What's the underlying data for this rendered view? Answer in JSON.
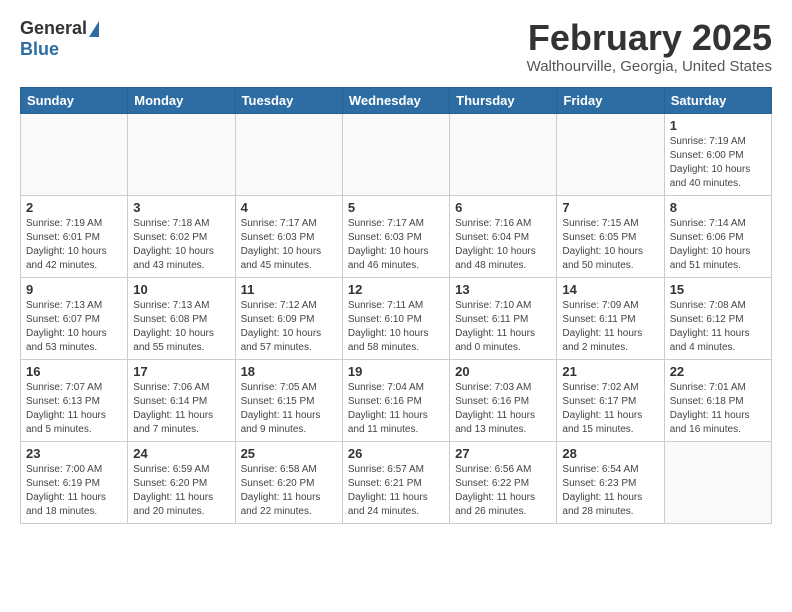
{
  "header": {
    "logo_general": "General",
    "logo_blue": "Blue",
    "month_title": "February 2025",
    "location": "Walthourville, Georgia, United States"
  },
  "weekdays": [
    "Sunday",
    "Monday",
    "Tuesday",
    "Wednesday",
    "Thursday",
    "Friday",
    "Saturday"
  ],
  "weeks": [
    [
      {
        "day": "",
        "info": ""
      },
      {
        "day": "",
        "info": ""
      },
      {
        "day": "",
        "info": ""
      },
      {
        "day": "",
        "info": ""
      },
      {
        "day": "",
        "info": ""
      },
      {
        "day": "",
        "info": ""
      },
      {
        "day": "1",
        "info": "Sunrise: 7:19 AM\nSunset: 6:00 PM\nDaylight: 10 hours\nand 40 minutes."
      }
    ],
    [
      {
        "day": "2",
        "info": "Sunrise: 7:19 AM\nSunset: 6:01 PM\nDaylight: 10 hours\nand 42 minutes."
      },
      {
        "day": "3",
        "info": "Sunrise: 7:18 AM\nSunset: 6:02 PM\nDaylight: 10 hours\nand 43 minutes."
      },
      {
        "day": "4",
        "info": "Sunrise: 7:17 AM\nSunset: 6:03 PM\nDaylight: 10 hours\nand 45 minutes."
      },
      {
        "day": "5",
        "info": "Sunrise: 7:17 AM\nSunset: 6:03 PM\nDaylight: 10 hours\nand 46 minutes."
      },
      {
        "day": "6",
        "info": "Sunrise: 7:16 AM\nSunset: 6:04 PM\nDaylight: 10 hours\nand 48 minutes."
      },
      {
        "day": "7",
        "info": "Sunrise: 7:15 AM\nSunset: 6:05 PM\nDaylight: 10 hours\nand 50 minutes."
      },
      {
        "day": "8",
        "info": "Sunrise: 7:14 AM\nSunset: 6:06 PM\nDaylight: 10 hours\nand 51 minutes."
      }
    ],
    [
      {
        "day": "9",
        "info": "Sunrise: 7:13 AM\nSunset: 6:07 PM\nDaylight: 10 hours\nand 53 minutes."
      },
      {
        "day": "10",
        "info": "Sunrise: 7:13 AM\nSunset: 6:08 PM\nDaylight: 10 hours\nand 55 minutes."
      },
      {
        "day": "11",
        "info": "Sunrise: 7:12 AM\nSunset: 6:09 PM\nDaylight: 10 hours\nand 57 minutes."
      },
      {
        "day": "12",
        "info": "Sunrise: 7:11 AM\nSunset: 6:10 PM\nDaylight: 10 hours\nand 58 minutes."
      },
      {
        "day": "13",
        "info": "Sunrise: 7:10 AM\nSunset: 6:11 PM\nDaylight: 11 hours\nand 0 minutes."
      },
      {
        "day": "14",
        "info": "Sunrise: 7:09 AM\nSunset: 6:11 PM\nDaylight: 11 hours\nand 2 minutes."
      },
      {
        "day": "15",
        "info": "Sunrise: 7:08 AM\nSunset: 6:12 PM\nDaylight: 11 hours\nand 4 minutes."
      }
    ],
    [
      {
        "day": "16",
        "info": "Sunrise: 7:07 AM\nSunset: 6:13 PM\nDaylight: 11 hours\nand 5 minutes."
      },
      {
        "day": "17",
        "info": "Sunrise: 7:06 AM\nSunset: 6:14 PM\nDaylight: 11 hours\nand 7 minutes."
      },
      {
        "day": "18",
        "info": "Sunrise: 7:05 AM\nSunset: 6:15 PM\nDaylight: 11 hours\nand 9 minutes."
      },
      {
        "day": "19",
        "info": "Sunrise: 7:04 AM\nSunset: 6:16 PM\nDaylight: 11 hours\nand 11 minutes."
      },
      {
        "day": "20",
        "info": "Sunrise: 7:03 AM\nSunset: 6:16 PM\nDaylight: 11 hours\nand 13 minutes."
      },
      {
        "day": "21",
        "info": "Sunrise: 7:02 AM\nSunset: 6:17 PM\nDaylight: 11 hours\nand 15 minutes."
      },
      {
        "day": "22",
        "info": "Sunrise: 7:01 AM\nSunset: 6:18 PM\nDaylight: 11 hours\nand 16 minutes."
      }
    ],
    [
      {
        "day": "23",
        "info": "Sunrise: 7:00 AM\nSunset: 6:19 PM\nDaylight: 11 hours\nand 18 minutes."
      },
      {
        "day": "24",
        "info": "Sunrise: 6:59 AM\nSunset: 6:20 PM\nDaylight: 11 hours\nand 20 minutes."
      },
      {
        "day": "25",
        "info": "Sunrise: 6:58 AM\nSunset: 6:20 PM\nDaylight: 11 hours\nand 22 minutes."
      },
      {
        "day": "26",
        "info": "Sunrise: 6:57 AM\nSunset: 6:21 PM\nDaylight: 11 hours\nand 24 minutes."
      },
      {
        "day": "27",
        "info": "Sunrise: 6:56 AM\nSunset: 6:22 PM\nDaylight: 11 hours\nand 26 minutes."
      },
      {
        "day": "28",
        "info": "Sunrise: 6:54 AM\nSunset: 6:23 PM\nDaylight: 11 hours\nand 28 minutes."
      },
      {
        "day": "",
        "info": ""
      }
    ]
  ]
}
